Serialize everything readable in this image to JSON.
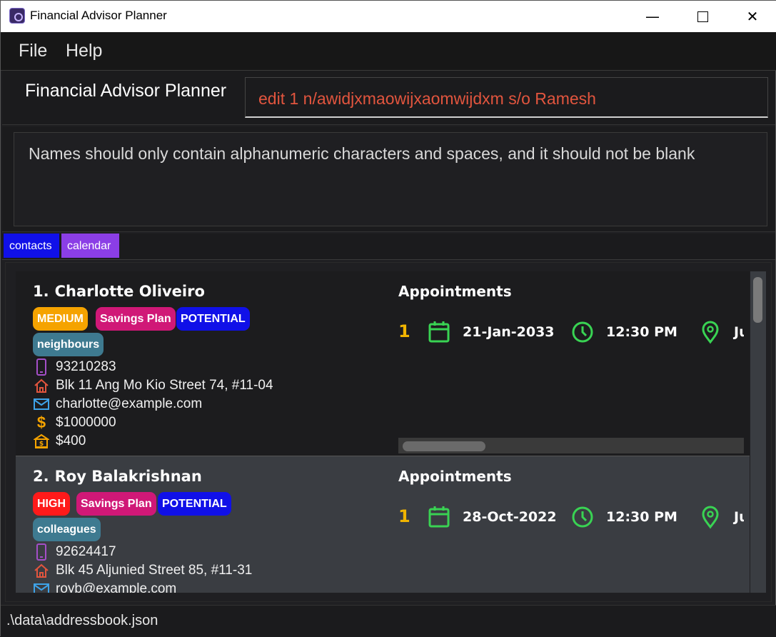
{
  "window": {
    "title": "Financial Advisor Planner",
    "controls": {
      "minimize": "—",
      "close": "✕"
    }
  },
  "menu": {
    "file": "File",
    "help": "Help"
  },
  "command": {
    "label": "Financial Advisor Planner",
    "value": "edit 1 n/awidjxmaowijxaomwijdxm s/o Ramesh"
  },
  "result": {
    "message": "Names should only contain alphanumeric characters and spaces, and it should not be blank"
  },
  "tabs": [
    {
      "label": "contacts",
      "color": "#1010e8"
    },
    {
      "label": "calendar",
      "color": "#8b3ee6"
    }
  ],
  "persons": [
    {
      "index": "1.",
      "name": "Charlotte Oliveiro",
      "tags": [
        "MEDIUM",
        "Savings Plan",
        "POTENTIAL",
        "neighbours"
      ],
      "phone": "93210283",
      "address": "Blk 11 Ang Mo Kio Street 74, #11-04",
      "email": "charlotte@example.com",
      "income": "$1000000",
      "monthly": "$400",
      "appointments_title": "Appointments",
      "appointment": {
        "index": "1",
        "date": "21-Jan-2033",
        "time": "12:30 PM",
        "location": "Jurong"
      }
    },
    {
      "index": "2.",
      "name": "Roy Balakrishnan",
      "tags": [
        "HIGH",
        "Savings Plan",
        "POTENTIAL",
        "colleagues"
      ],
      "phone": "92624417",
      "address": "Blk 45 Aljunied Street 85, #11-31",
      "email": "royb@example.com",
      "appointments_title": "Appointments",
      "appointment": {
        "index": "1",
        "date": "28-Oct-2022",
        "time": "12:30 PM",
        "location": "Jurong"
      }
    }
  ],
  "status": {
    "path": ".\\data\\addressbook.json"
  },
  "colors": {
    "error_text": "#e2553e",
    "tag_medium": "#f5a300",
    "tag_high": "#ff1a1a",
    "tag_plan": "#d01877",
    "tag_potential": "#1010e8",
    "tag_group": "#3e7a90",
    "appointment_index": "#f0b400",
    "appointment_icon": "#39d353"
  },
  "icons": [
    "app-icon",
    "phone-icon",
    "home-icon",
    "email-icon",
    "dollar-icon",
    "bank-icon",
    "calendar-icon",
    "clock-icon",
    "location-pin-icon"
  ]
}
